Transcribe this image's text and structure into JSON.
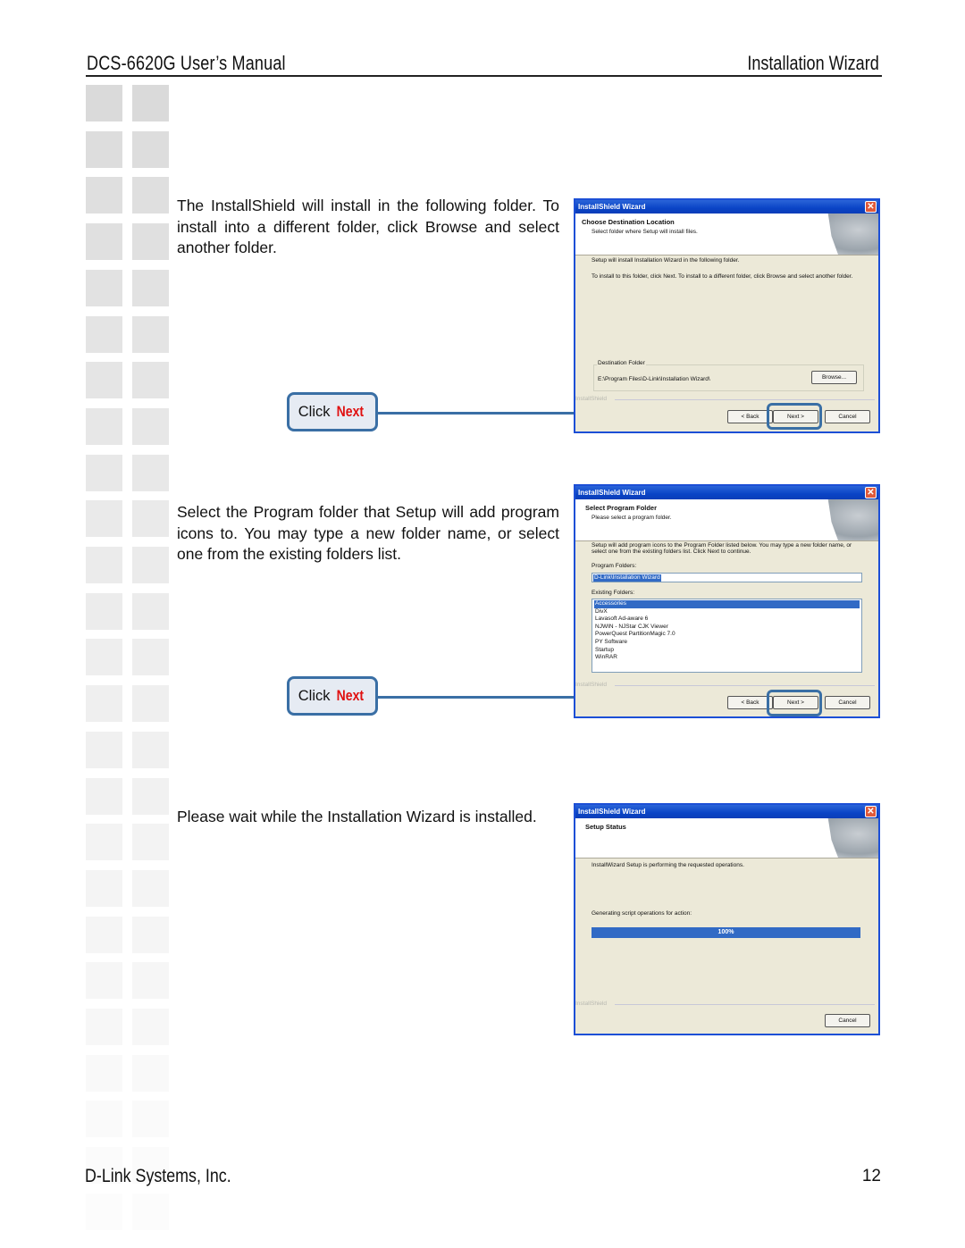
{
  "header": {
    "manual_title": "DCS-6620G User’s Manual",
    "section_title": "Installation Wizard"
  },
  "footer": {
    "company": "D-Link Systems, Inc.",
    "page_number": "12"
  },
  "steps": [
    {
      "description": "The InstallShield will install in the following folder. To install into a different folder, click Browse and select another folder.",
      "callout": {
        "prefix": "Click",
        "action": "Next"
      },
      "window": {
        "title": "InstallShield Wizard",
        "close_icon": "close-icon",
        "banner_title": "Choose Destination Location",
        "banner_subtitle": "Select folder where Setup will install files.",
        "line1": "Setup will install Installation Wizard in the following folder.",
        "line2": "To install to this folder, click Next. To install to a different folder, click Browse and select another folder.",
        "group_label": "Destination Folder",
        "destination_path": "E:\\Program Files\\D-Link\\Installation Wizard\\",
        "browse_label": "Browse...",
        "brand_label": "InstallShield",
        "back_label": "< Back",
        "next_label": "Next >",
        "cancel_label": "Cancel"
      }
    },
    {
      "description": "Select the Program folder that Setup will add program icons to. You may type a new folder name, or select one from the existing folders list.",
      "callout": {
        "prefix": "Click",
        "action": "Next"
      },
      "window": {
        "title": "InstallShield Wizard",
        "banner_title": "Select Program Folder",
        "banner_subtitle": "Please select a program folder.",
        "line1": "Setup will add program icons to the Program Folder listed below. You may type a new folder name, or select one from the existing folders list. Click Next to continue.",
        "program_folders_label": "Program Folders:",
        "program_folder_value": "D-Link\\Installation Wizard",
        "existing_folders_label": "Existing Folders:",
        "existing_folders": [
          "Accessories",
          "DivX",
          "Lavasoft Ad-aware 6",
          "NJWIN - NJStar CJK Viewer",
          "PowerQuest PartitionMagic 7.0",
          "PY Software",
          "Startup",
          "WinRAR"
        ],
        "selected_folder": "Accessories",
        "brand_label": "InstallShield",
        "back_label": "< Back",
        "next_label": "Next >",
        "cancel_label": "Cancel"
      }
    },
    {
      "description": "Please wait while the Installation Wizard is installed.",
      "window": {
        "title": "InstallShield Wizard",
        "banner_title": "Setup Status",
        "line1": "InstallWizard Setup is performing the requested operations.",
        "line2": "Generating script operations for action:",
        "progress_percent": 100,
        "progress_label": "100%",
        "brand_label": "InstallShield",
        "cancel_label": "Cancel"
      }
    }
  ],
  "colors": {
    "accent_blue": "#3a6fa5",
    "next_red": "#e01010",
    "xp_title_blue": "#0a44c6",
    "dialog_bg": "#ece9d8"
  }
}
